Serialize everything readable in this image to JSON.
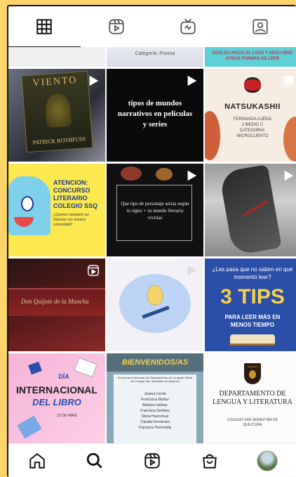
{
  "tabs": [
    {
      "name": "grid-icon",
      "active": true
    },
    {
      "name": "reels-icon",
      "active": false
    },
    {
      "name": "igtv-icon",
      "active": false
    },
    {
      "name": "tagged-icon",
      "active": false
    }
  ],
  "posts": {
    "p0_1": "Categoría: Poema",
    "p0_2": "DESLIZA HACIA EL LADO Y DESCUBRE OTRAS FORMAS DE LEER",
    "p1_0_title": "VIENTO",
    "p1_0_author": "PATRICK ROTHFUSS",
    "p1_1": "tipos de mundos narrativos en películas y series",
    "p1_2_title": "NATSUKASHII",
    "p1_2_sub": "FERNANDA OJEDA 2 MEDIO C CATEGORIA: MICROCUENTO",
    "p2_0_title": "ATENCION: CONCURSO LITERARIO COLEGIO SSQ",
    "p2_0_sub": "¿Quieres compartir tus historias con nuestra comunidad?",
    "p2_1": "Que tipo de personaje serias según tu signo + su mundo literario vivirías",
    "p3_0": "Don Quijote de la Mancha",
    "p3_2_top": "¿Les pasa que no saben en qué momento leer?",
    "p3_2_big": "3 TIPS",
    "p3_2_sub": "PARA LEER MÁS EN MENOS TIEMPO",
    "p4_0_l1": "DÍA",
    "p4_0_l2": "INTERNACIONAL",
    "p4_0_l3": "DEL LIBRO",
    "p4_0_date": "23 DE ABRIL",
    "p4_1_title": "BIENVENIDOS/AS",
    "p4_1_sub": "Somos las profesoras del Departamento de Lenguaje Media del Colegio San Sebastián de Quilicura",
    "p4_1_names": [
      "Javiera Cerda",
      "Francesca Muñoz",
      "Bárbara Salinas",
      "Francisca Orellana",
      "Maria Huenchual",
      "Claudia Fernández",
      "Francisca Hermosilla"
    ],
    "p4_2_seal": "COLEGIO",
    "p4_2_title": "DEPARTAMENTO DE LENGUA Y LITERATURA",
    "p4_2_sub": "COLEGIO SAN SEBASTIÁN DE QUILICURA"
  },
  "nav": [
    "home-icon",
    "search-icon",
    "reels-icon",
    "shop-icon",
    "profile-avatar"
  ],
  "colors": {
    "background": "#fbd46a",
    "accent_orange": "#f0763a",
    "blue": "#2b4fa8"
  }
}
